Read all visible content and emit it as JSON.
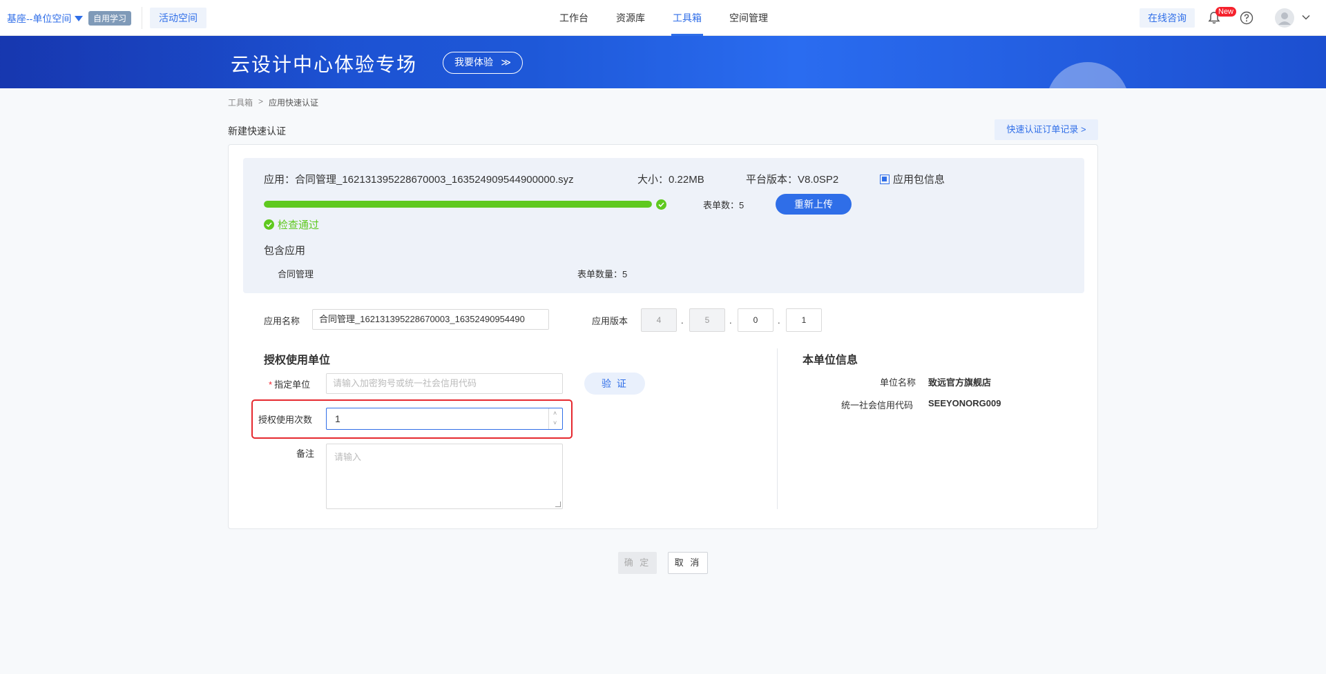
{
  "topbar": {
    "space_name": "基座--单位空间",
    "badge": "自用学习",
    "activity": "活动空间",
    "nav": [
      {
        "label": "工作台"
      },
      {
        "label": "资源库"
      },
      {
        "label": "工具箱"
      },
      {
        "label": "空间管理"
      }
    ],
    "consult": "在线咨询",
    "new_badge": "New"
  },
  "banner": {
    "title": "云设计中心体验专场",
    "button": "我要体验",
    "button_arrow": "≫"
  },
  "breadcrumb": {
    "root": "工具箱",
    "separator": ">",
    "current": "应用快速认证"
  },
  "page": {
    "title": "新建快速认证",
    "records_button": "快速认证订单记录 >"
  },
  "package": {
    "app_text": "应用：合同管理_162131395228670003_163524909544900000.syz",
    "size_text": "大小：0.22MB",
    "platform_text": "平台版本：V8.0SP2",
    "info_link": "应用包信息",
    "progress_fraction": 1.0,
    "forms_text": "表单数：5",
    "reupload": "重新上传",
    "check_status": "检查通过",
    "contains_title": "包含应用",
    "contains_name": "合同管理",
    "contains_forms": "表单数量：5",
    "success_color": "#5fc91f"
  },
  "app_name": {
    "label": "应用名称",
    "value": "合同管理_162131395228670003_16352490954490"
  },
  "app_version": {
    "label": "应用版本",
    "parts": [
      "4",
      "5",
      "0",
      "1"
    ],
    "dot": "."
  },
  "auth": {
    "title": "授权使用单位",
    "unit_label": "指定单位",
    "required_mark": "*",
    "unit_placeholder": "请输入加密狗号或统一社会信用代码",
    "verify": "验 证",
    "count_label": "授权使用次数",
    "count_value": "1",
    "remark_label": "备注",
    "remark_placeholder": "请输入"
  },
  "unit_info": {
    "title": "本单位信息",
    "name_label": "单位名称",
    "name_value": "致远官方旗舰店",
    "code_label": "统一社会信用代码",
    "code_value": "SEEYONORG009"
  },
  "footer": {
    "ok": "确 定",
    "cancel": "取 消"
  },
  "colors": {
    "accent": "#2f6ee8",
    "highlight_border": "#e5282e"
  }
}
